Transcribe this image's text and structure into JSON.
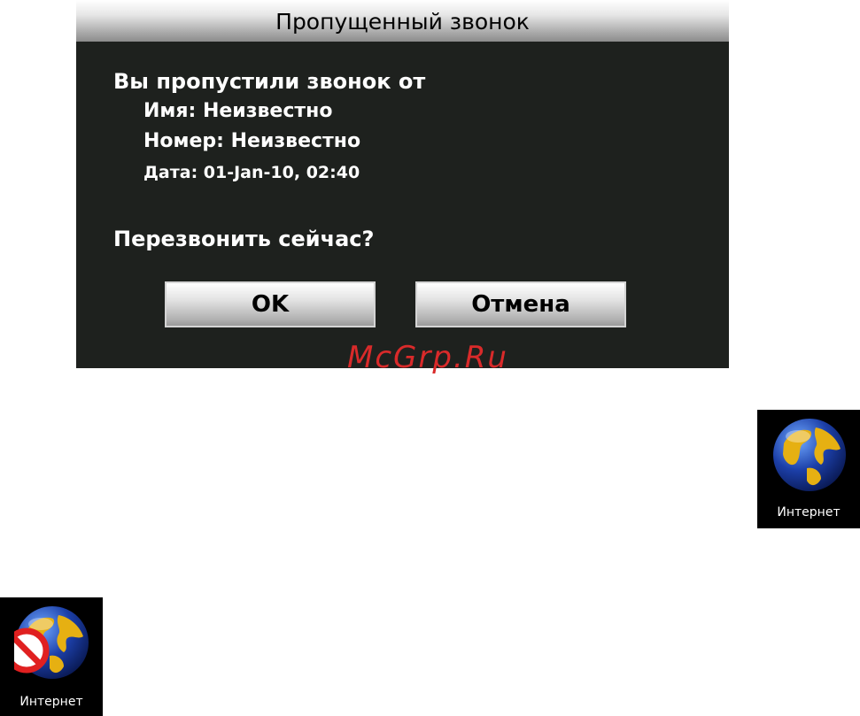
{
  "dialog": {
    "title": "Пропущенный звонок",
    "message": "Вы пропустили звонок от",
    "name_line": "Имя: Неизвестно",
    "number_line": "Номер: Неизвестно",
    "date_line": "Дата: 01-Jan-10, 02:40",
    "question": "Перезвонить сейчас?",
    "ok_label": "OK",
    "cancel_label": "Отмена"
  },
  "watermark": "McGrp.Ru",
  "icons": {
    "internet": {
      "label": "Интернет",
      "icon": "globe-icon"
    },
    "internet_disabled": {
      "label": "Интернет",
      "icon": "globe-no-entry-icon"
    }
  },
  "colors": {
    "dialog_bg": "#1e211e",
    "watermark": "#d92a2a",
    "prohibit_red": "#e02020",
    "globe_ocean": "#1c3fa8",
    "globe_land": "#e6b012"
  }
}
